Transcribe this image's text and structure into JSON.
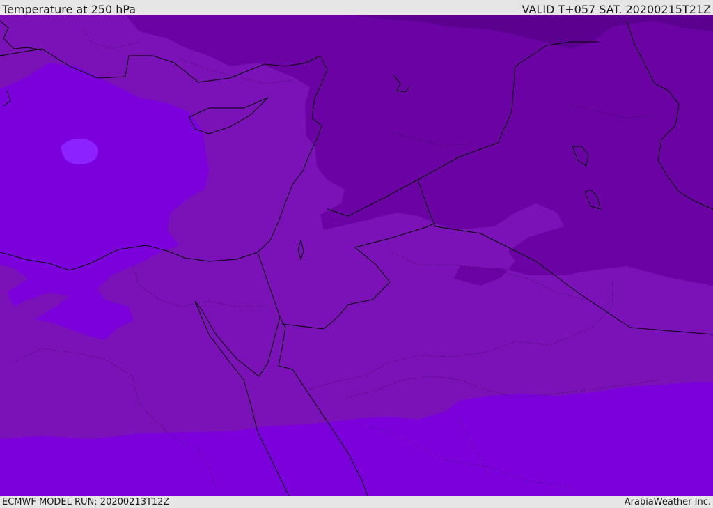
{
  "header": {
    "title": "Temperature at 250 hPa",
    "valid": "VALID T+057 SAT. 20200215T21Z"
  },
  "footer": {
    "model_run": "ECMWF MODEL RUN: 20200213T12Z",
    "credit": "ArabiaWeather Inc."
  },
  "map": {
    "field": "Temperature",
    "level": "250 hPa",
    "colors": {
      "band_warm_light": "#7b00dc",
      "band_warm_spot": "#8b22ff",
      "band_mid": "#7a12b8",
      "band_cool": "#6a02a4",
      "band_coldest": "#5c0090",
      "coastline": "#000000"
    }
  }
}
